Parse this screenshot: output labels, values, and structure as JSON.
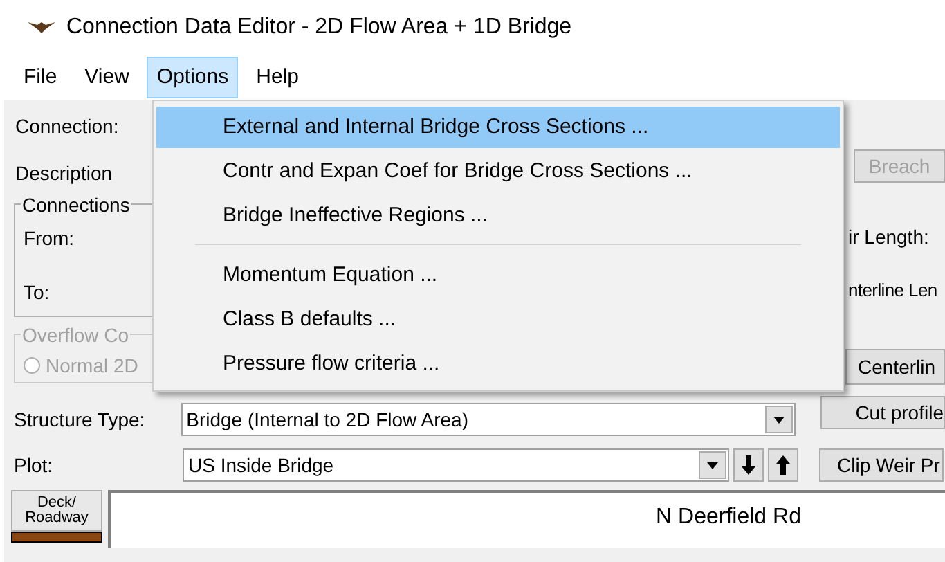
{
  "window": {
    "title": "Connection Data Editor - 2D Flow Area + 1D Bridge"
  },
  "menu": [
    {
      "label": "File",
      "selected": false
    },
    {
      "label": "View",
      "selected": false
    },
    {
      "label": "Options",
      "selected": true
    },
    {
      "label": "Help",
      "selected": false
    }
  ],
  "dropdown": [
    {
      "kind": "item",
      "label": "External and Internal Bridge Cross Sections ...",
      "highlighted": true
    },
    {
      "kind": "item",
      "label": "Contr and Expan Coef for Bridge Cross Sections ...",
      "highlighted": false
    },
    {
      "kind": "item",
      "label": "Bridge Ineffective Regions ...",
      "highlighted": false
    },
    {
      "kind": "separator"
    },
    {
      "kind": "item",
      "label": "Momentum Equation ...",
      "highlighted": false
    },
    {
      "kind": "item",
      "label": "Class B defaults ...",
      "highlighted": false
    },
    {
      "kind": "item",
      "label": "Pressure flow criteria ...",
      "highlighted": false
    }
  ],
  "form": {
    "connection_label": "Connection:",
    "description_label": "Description",
    "breach_button": {
      "label": "Breach",
      "disabled": true
    },
    "connections_group": {
      "title": "Connections",
      "from_label": "From:",
      "to_label": "To:"
    },
    "weir_length_label": "ir Length:",
    "centerline_length_label": "nterline Len",
    "overflow_group": {
      "title": "Overflow Co",
      "disabled": true,
      "radio": {
        "label": "Normal 2D",
        "checked": false
      }
    },
    "centerline_button": "Centerlin",
    "structure_type": {
      "label": "Structure Type:",
      "value": "Bridge (Internal to 2D Flow Area)"
    },
    "cut_profile_button": "Cut profile",
    "plot": {
      "label": "Plot:",
      "value": "US Inside Bridge"
    },
    "clip_weir_button": "Clip Weir Pr",
    "deck_button": "Deck/ Roadway",
    "plot_panel": {
      "road_label": "N Deerfield Rd"
    }
  }
}
